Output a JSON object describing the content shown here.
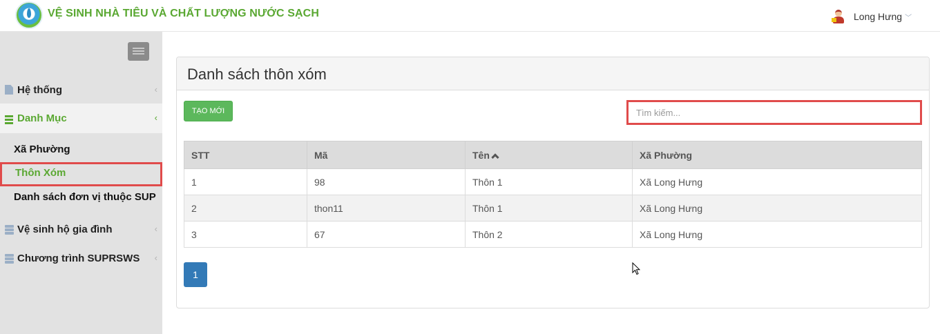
{
  "header": {
    "app_title": "VỆ SINH NHÀ TIÊU VÀ CHẤT LƯỢNG NƯỚC SẠCH",
    "user_name": "Long Hưng",
    "user_chevron": "﹀"
  },
  "sidebar": {
    "items": [
      {
        "label": "Hệ thống",
        "icon": "document-icon"
      },
      {
        "label": "Danh Mục",
        "icon": "list-icon"
      },
      {
        "label": "Vệ sinh hộ gia đình",
        "icon": "server-icon"
      },
      {
        "label": "Chương trình SUPRSWS",
        "icon": "server-icon"
      }
    ],
    "subitems": [
      {
        "label": "Xã Phường"
      },
      {
        "label": "Thôn Xóm"
      },
      {
        "label": "Danh sách đơn vị thuộc SUP"
      }
    ],
    "caret": "‹"
  },
  "main": {
    "title": "Danh sách thôn xóm",
    "create_label": "TẠO MỚI",
    "search_placeholder": "Tìm kiếm...",
    "table": {
      "headers": [
        "STT",
        "Mã",
        "Tên",
        "Xã Phường"
      ],
      "rows": [
        [
          "1",
          "98",
          "Thôn 1",
          "Xã Long Hưng"
        ],
        [
          "2",
          "thon11",
          "Thôn 1",
          "Xã Long Hưng"
        ],
        [
          "3",
          "67",
          "Thôn 2",
          "Xã Long Hưng"
        ]
      ]
    },
    "pagination": {
      "current": "1"
    }
  },
  "colors": {
    "brand_green": "#5aa832",
    "accent_blue": "#337ab7",
    "highlight_red": "#e04b4b"
  }
}
